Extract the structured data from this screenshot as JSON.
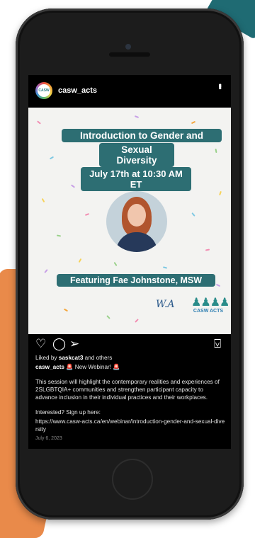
{
  "account": {
    "username": "casw_acts",
    "avatar_text": "CASW"
  },
  "post": {
    "title_line1": "Introduction to Gender and",
    "title_line2": "Sexual Diversity",
    "date_line": "July 17th at 10:30 AM ET",
    "featuring": "Featuring Fae Johnstone, MSW",
    "logo_left": "W.A",
    "logo_right": "CASW ACTS"
  },
  "actions": {
    "like_icon": "heart-outline-icon",
    "comment_icon": "comment-icon",
    "share_icon": "send-icon",
    "save_icon": "bookmark-icon"
  },
  "caption": {
    "liked_prefix": "Liked by",
    "liked_user": "saskcat3",
    "liked_suffix": "and others",
    "author": "casw_acts",
    "headline": "🚨 New Webinar! 🚨",
    "body": "This session will highlight the contemporary realities and experiences of 2SLGBTQIA+ communities and strengthen participant capacity to advance inclusion in their individual practices and their workplaces.",
    "signup": "Interested? Sign up here:",
    "link": "https://www.casw-acts.ca/en/webinar/introduction-gender-and-sexual-diversity",
    "date": "July 6, 2023"
  },
  "colors": {
    "banner": "#2d6e73",
    "accent_orange": "#e98a4a",
    "screen_bg": "#000000",
    "post_bg": "#f3f3f1"
  }
}
